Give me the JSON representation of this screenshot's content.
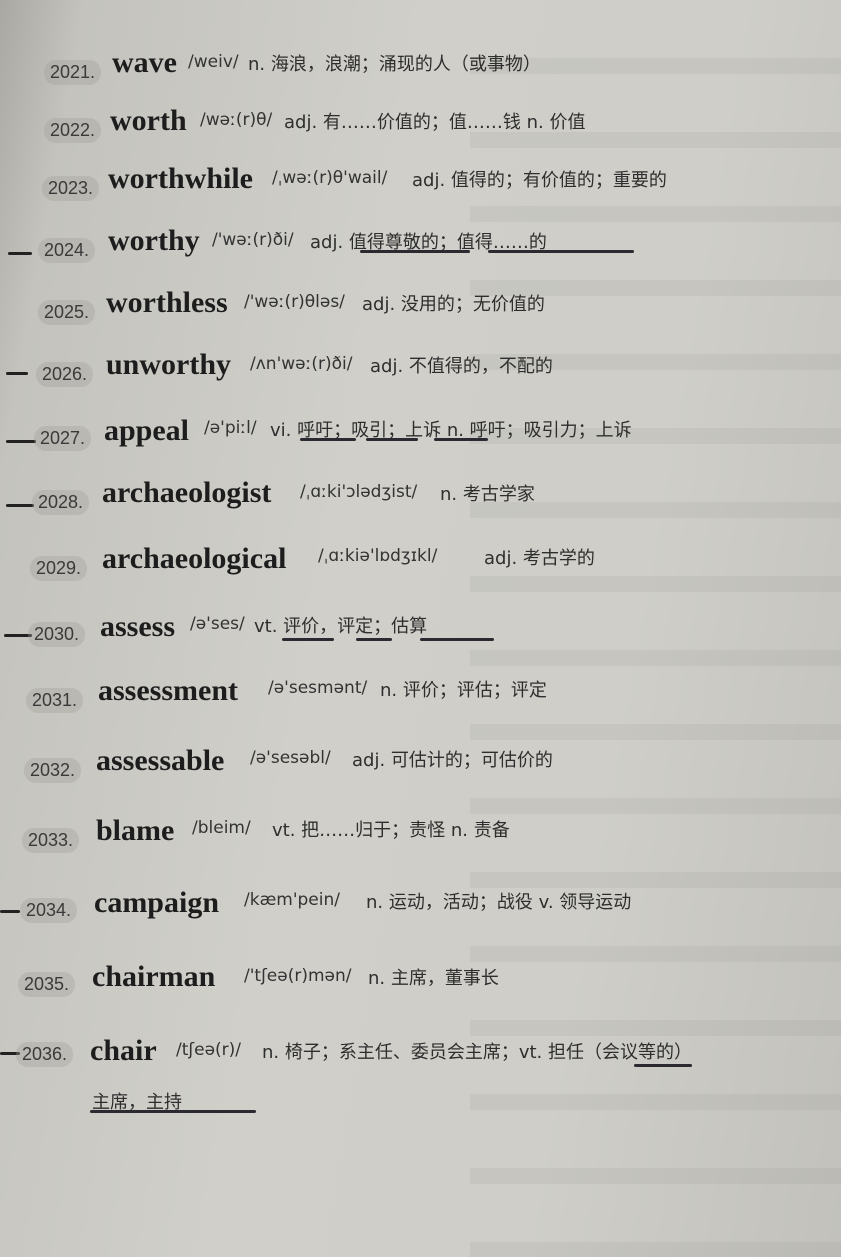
{
  "entries": [
    {
      "num": "2021.",
      "word": "wave",
      "ipa": "/weiv/",
      "def": "n. 海浪，浪潮；涌现的人（或事物）"
    },
    {
      "num": "2022.",
      "word": "worth",
      "ipa": "/wəː(r)θ/",
      "def": "adj. 有……价值的；值……钱 n. 价值"
    },
    {
      "num": "2023.",
      "word": "worthwhile",
      "ipa": "/ˌwəː(r)θ'wail/",
      "def": "adj. 值得的；有价值的；重要的"
    },
    {
      "num": "2024.",
      "word": "worthy",
      "ipa": "/'wəː(r)ði/",
      "def": "adj. 值得尊敬的；值得……的"
    },
    {
      "num": "2025.",
      "word": "worthless",
      "ipa": "/'wəː(r)θləs/",
      "def": "adj. 没用的；无价值的"
    },
    {
      "num": "2026.",
      "word": "unworthy",
      "ipa": "/ʌn'wəː(r)ði/",
      "def": "adj. 不值得的，不配的"
    },
    {
      "num": "2027.",
      "word": "appeal",
      "ipa": "/ə'piːl/",
      "def": "vi. 呼吁；吸引；上诉 n. 呼吁；吸引力；上诉"
    },
    {
      "num": "2028.",
      "word": "archaeologist",
      "ipa": "/ˌɑːki'ɔlədʒist/",
      "def": "n. 考古学家"
    },
    {
      "num": "2029.",
      "word": "archaeological",
      "ipa": "/ˌɑːkiə'lɒdʒɪkl/",
      "def": "adj. 考古学的"
    },
    {
      "num": "2030.",
      "word": "assess",
      "ipa": "/ə'ses/",
      "def": "vt. 评价，评定；估算"
    },
    {
      "num": "2031.",
      "word": "assessment",
      "ipa": "/ə'sesmənt/",
      "def": "n. 评价；评估；评定"
    },
    {
      "num": "2032.",
      "word": "assessable",
      "ipa": "/ə'sesəbl/",
      "def": "adj. 可估计的；可估价的"
    },
    {
      "num": "2033.",
      "word": "blame",
      "ipa": "/bleim/",
      "def": "vt. 把……归于；责怪 n. 责备"
    },
    {
      "num": "2034.",
      "word": "campaign",
      "ipa": "/kæm'pein/",
      "def": "n. 运动，活动；战役 v. 领导运动"
    },
    {
      "num": "2035.",
      "word": "chairman",
      "ipa": "/'tʃeə(r)mən/",
      "def": "n. 主席，董事长"
    },
    {
      "num": "2036.",
      "word": "chair",
      "ipa": "/tʃeə(r)/",
      "def": "n. 椅子；系主任、委员会主席；vt. 担任（会议等的）"
    }
  ],
  "continuation": "主席，主持"
}
